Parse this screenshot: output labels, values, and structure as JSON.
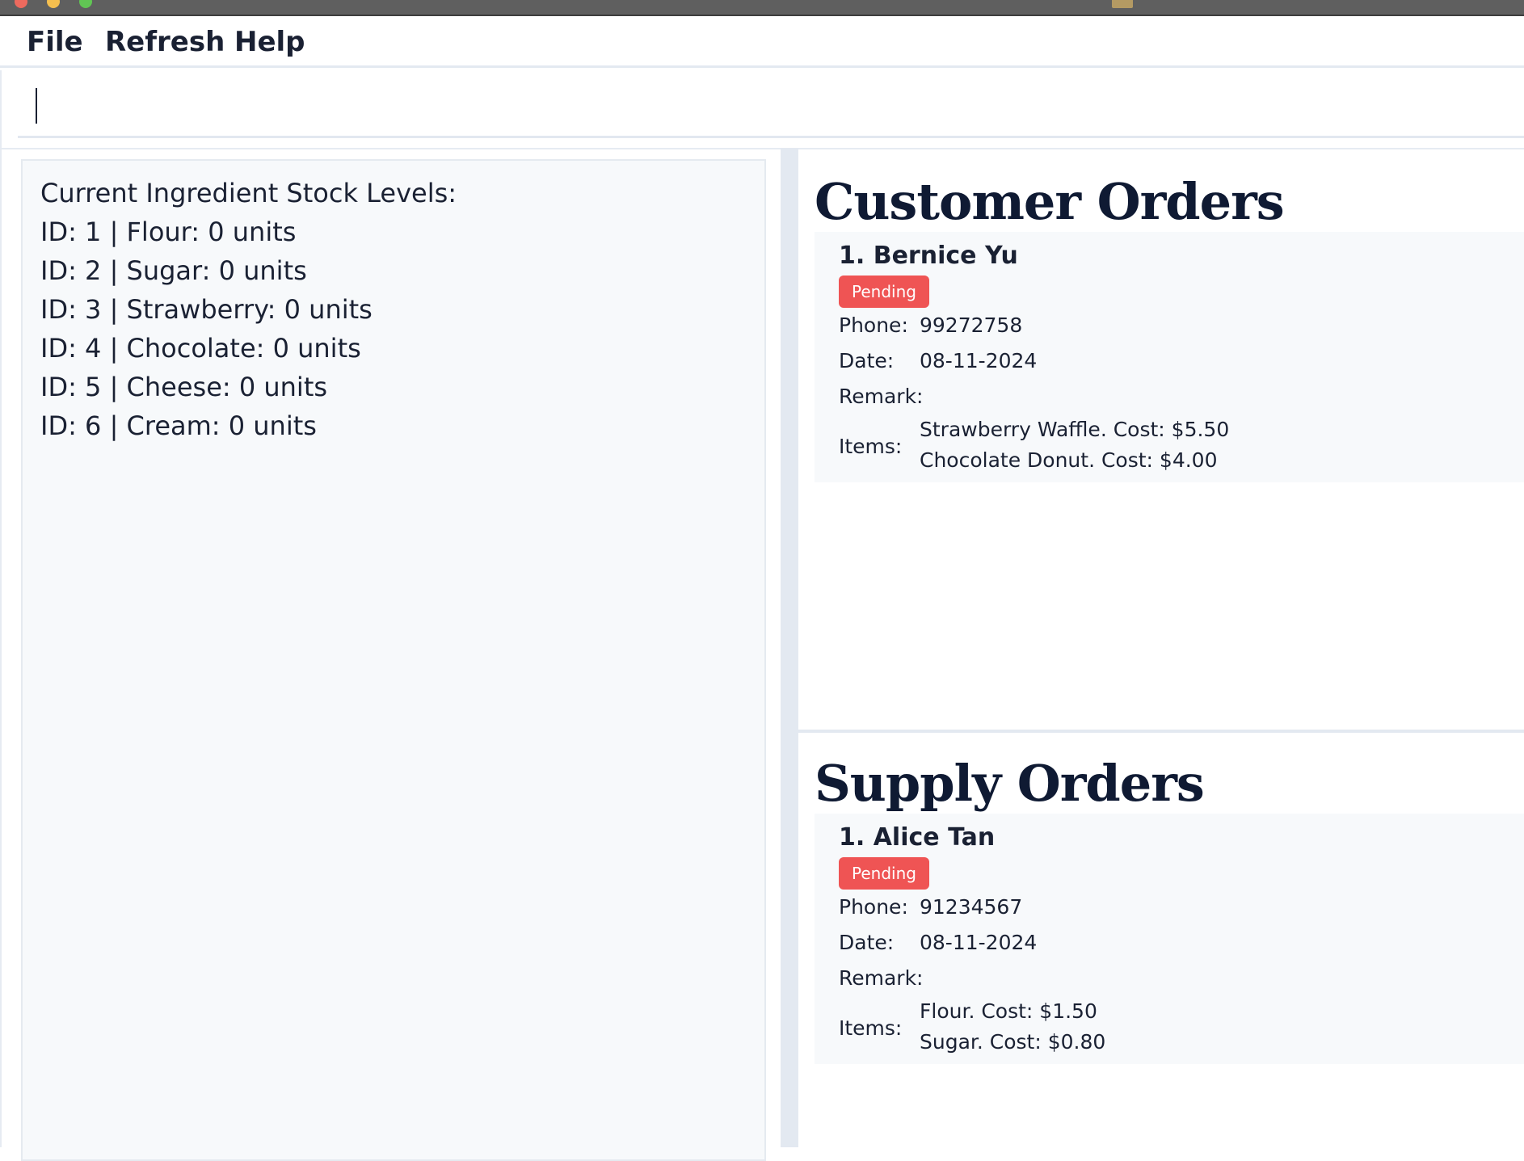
{
  "window": {
    "colors": {
      "close": "#ed6a5e",
      "minimize": "#f5bf4f",
      "maximize": "#61c554"
    }
  },
  "menu": {
    "items": [
      {
        "label": "File"
      },
      {
        "label": "Refresh"
      },
      {
        "label": "Help"
      }
    ]
  },
  "command": {
    "value": "",
    "placeholder": ""
  },
  "stock": {
    "heading": "Current Ingredient Stock Levels:",
    "lines": [
      "ID: 1 | Flour: 0 units",
      "ID: 2 | Sugar: 0 units",
      "ID: 3 | Strawberry: 0 units",
      "ID: 4 | Chocolate: 0 units",
      "ID: 5 | Cheese: 0 units",
      "ID: 6 | Cream: 0 units"
    ]
  },
  "customer_orders": {
    "title": "Customer Orders",
    "orders": [
      {
        "name": "1. Bernice Yu",
        "status": "Pending",
        "phone_label": "Phone:",
        "phone": "99272758",
        "date_label": "Date:",
        "date": "08-11-2024",
        "remark_label": "Remark:",
        "remark": "",
        "items_label": "Items:",
        "items": [
          "Strawberry Waffle. Cost: $5.50",
          "Chocolate Donut. Cost: $4.00"
        ]
      }
    ]
  },
  "supply_orders": {
    "title": "Supply Orders",
    "orders": [
      {
        "name": "1. Alice Tan",
        "status": "Pending",
        "phone_label": "Phone:",
        "phone": "91234567",
        "date_label": "Date:",
        "date": "08-11-2024",
        "remark_label": "Remark:",
        "remark": "",
        "items_label": "Items:",
        "items": [
          "Flour. Cost: $1.50",
          "Sugar. Cost: $0.80"
        ]
      }
    ]
  },
  "colors": {
    "pending_badge": "#ef5454",
    "card_background": "#f7f9fb",
    "divider": "#e3e9f1",
    "text": "#1a2133"
  }
}
